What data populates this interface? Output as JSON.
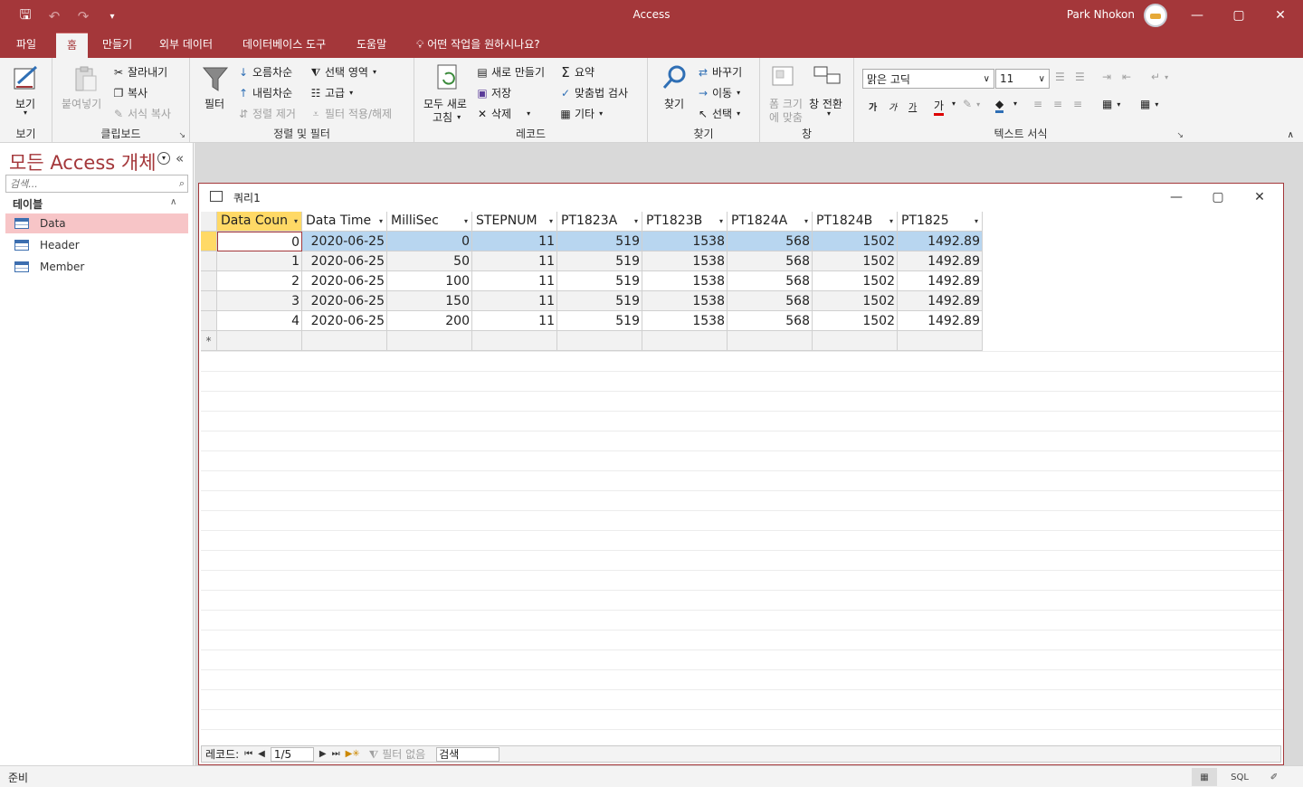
{
  "titlebar": {
    "app_title": "Access",
    "user_name": "Park Nhokon"
  },
  "tabs": [
    "파일",
    "홈",
    "만들기",
    "외부 데이터",
    "데이터베이스 도구",
    "도움말"
  ],
  "tell_me": "어떤 작업을 원하시나요?",
  "ribbon": {
    "views": {
      "view": "보기",
      "label": "보기"
    },
    "clipboard": {
      "paste": "붙여넣기",
      "cut": "잘라내기",
      "copy": "복사",
      "format_painter": "서식 복사",
      "label": "클립보드"
    },
    "sortfilter": {
      "filter": "필터",
      "asc": "오름차순",
      "desc": "내림차순",
      "remove_sort": "정렬 제거",
      "selection": "선택 영역",
      "advanced": "고급",
      "toggle_filter": "필터 적용/해제",
      "label": "정렬 및 필터"
    },
    "records": {
      "refresh1": "모두 새로",
      "refresh2": "고침",
      "new": "새로 만들기",
      "save": "저장",
      "delete": "삭제",
      "totals": "요약",
      "spelling": "맞춤법 검사",
      "more": "기타",
      "label": "레코드"
    },
    "find": {
      "find": "찾기",
      "replace": "바꾸기",
      "goto": "이동",
      "select": "선택",
      "label": "찾기"
    },
    "window": {
      "fit1": "폼 크기",
      "fit2": "에 맞춤",
      "switch1": "창 전환",
      "label": "창"
    },
    "text": {
      "font": "맑은 고딕",
      "size": "11",
      "bold": "가",
      "italic": "가",
      "underline": "가",
      "label": "텍스트 서식"
    }
  },
  "nav": {
    "title": "모든 Access 개체",
    "search_placeholder": "검색...",
    "section": "테이블",
    "items": [
      "Data",
      "Header",
      "Member"
    ]
  },
  "query": {
    "title": "쿼리1",
    "columns": [
      "Data Coun",
      "Data Time",
      "MilliSec",
      "STEPNUM",
      "PT1823A",
      "PT1823B",
      "PT1824A",
      "PT1824B",
      "PT1825"
    ],
    "rows": [
      [
        "0",
        "2020-06-25",
        "0",
        "11",
        "519",
        "1538",
        "568",
        "1502",
        "1492.89"
      ],
      [
        "1",
        "2020-06-25",
        "50",
        "11",
        "519",
        "1538",
        "568",
        "1502",
        "1492.89"
      ],
      [
        "2",
        "2020-06-25",
        "100",
        "11",
        "519",
        "1538",
        "568",
        "1502",
        "1492.89"
      ],
      [
        "3",
        "2020-06-25",
        "150",
        "11",
        "519",
        "1538",
        "568",
        "1502",
        "1492.89"
      ],
      [
        "4",
        "2020-06-25",
        "200",
        "11",
        "519",
        "1538",
        "568",
        "1502",
        "1492.89"
      ]
    ],
    "new_row_marker": "*"
  },
  "record_nav": {
    "label": "레코드:",
    "position": "1/5",
    "filter_status": "필터 없음",
    "search": "검색"
  },
  "status": {
    "text": "준비"
  }
}
